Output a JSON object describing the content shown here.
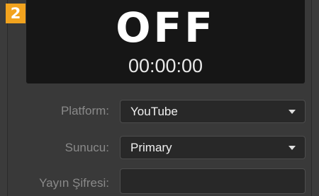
{
  "badge": "2",
  "status": {
    "state": "OFF",
    "timer": "00:00:00"
  },
  "form": {
    "platform": {
      "label": "Platform:",
      "value": "YouTube"
    },
    "server": {
      "label": "Sunucu:",
      "value": "Primary"
    },
    "stream_key": {
      "label": "Yayın Şifresi:",
      "value": ""
    }
  },
  "colors": {
    "badge": "#f2a31e",
    "panel_bg": "#393939",
    "status_bg": "#161616",
    "field_bg": "#282828"
  },
  "icons": {
    "dropdown": "chevron-down-icon"
  }
}
